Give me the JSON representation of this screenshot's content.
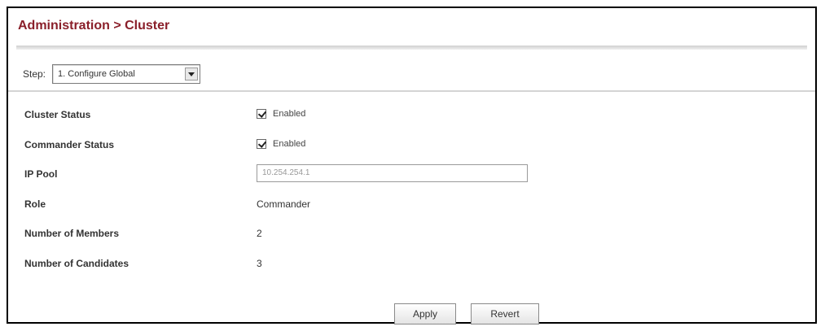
{
  "header": {
    "title": "Administration > Cluster"
  },
  "step": {
    "label": "Step:",
    "selected": "1. Configure Global"
  },
  "fields": {
    "cluster_status": {
      "label": "Cluster Status",
      "checkbox_label": "Enabled",
      "checked": true
    },
    "commander_status": {
      "label": "Commander Status",
      "checkbox_label": "Enabled",
      "checked": true
    },
    "ip_pool": {
      "label": "IP Pool",
      "value": "10.254.254.1"
    },
    "role": {
      "label": "Role",
      "value": "Commander"
    },
    "number_of_members": {
      "label": "Number of Members",
      "value": "2"
    },
    "number_of_candidates": {
      "label": "Number of Candidates",
      "value": "3"
    }
  },
  "buttons": {
    "apply": "Apply",
    "revert": "Revert"
  }
}
